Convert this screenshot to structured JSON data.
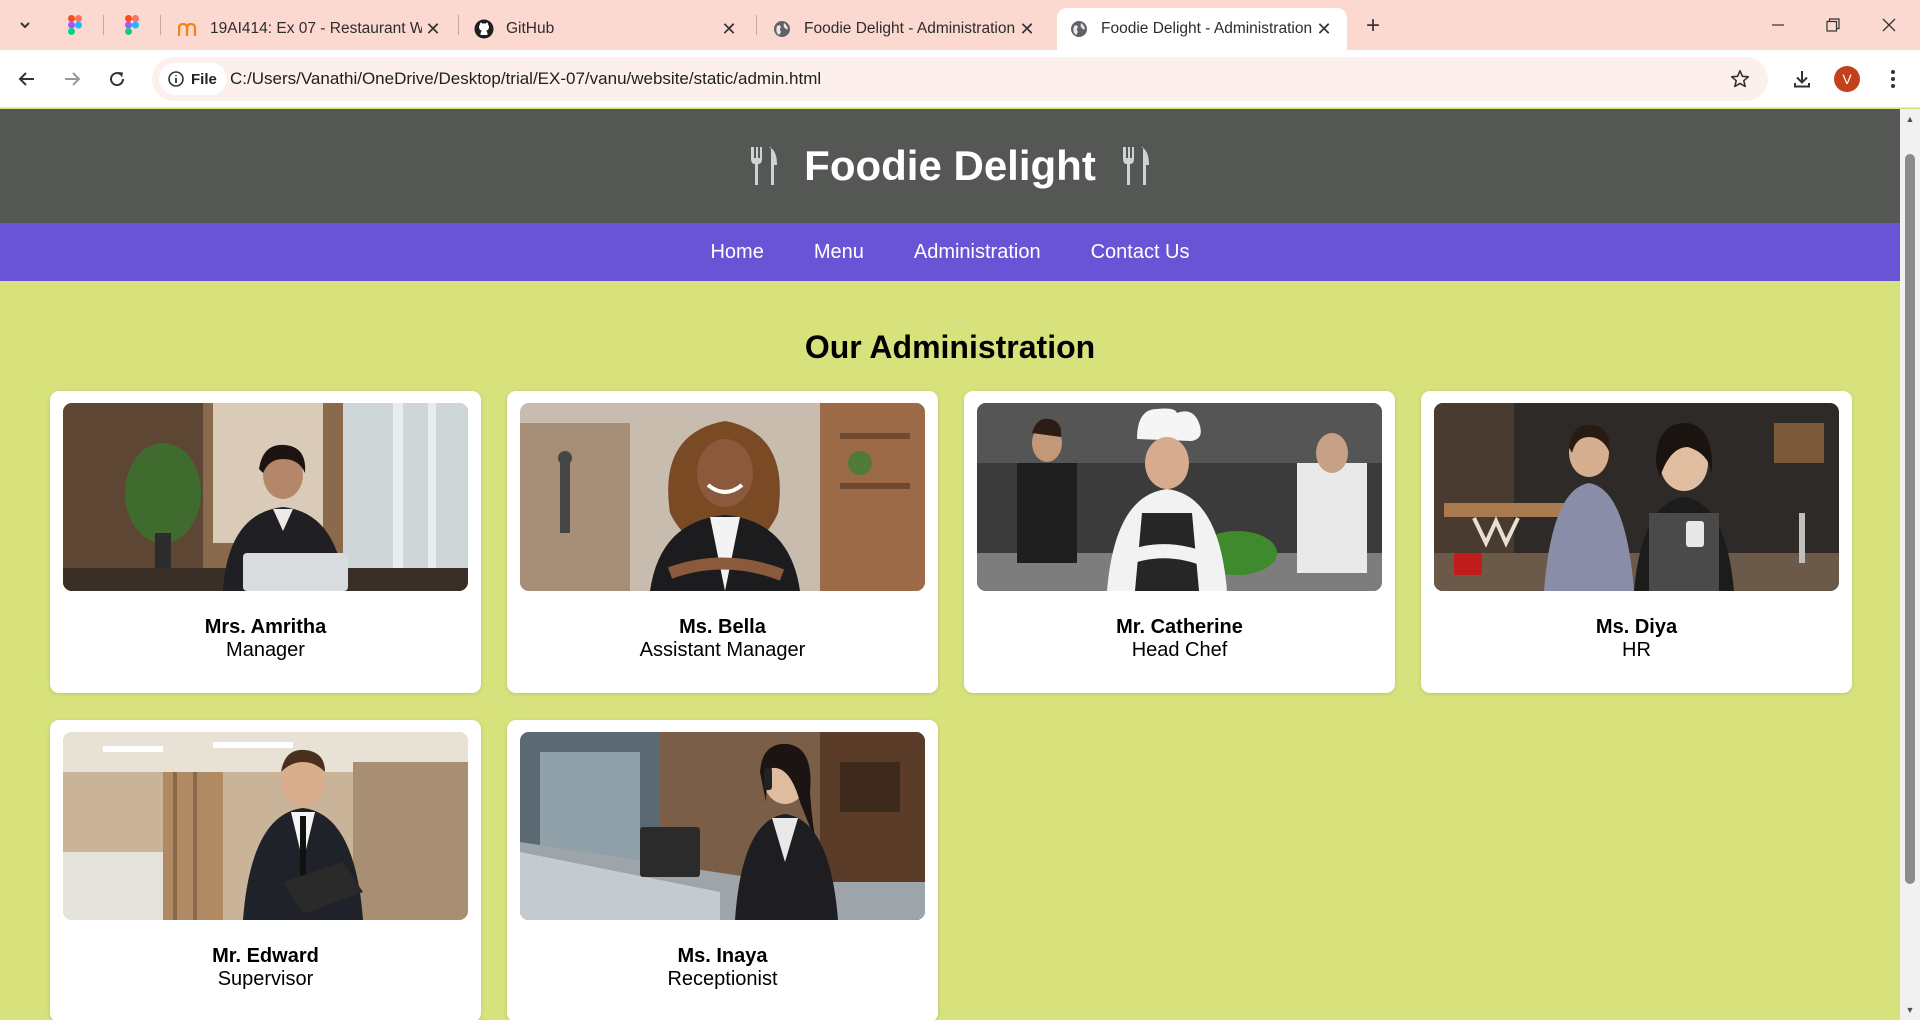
{
  "browser": {
    "tabs": [
      {
        "title": "",
        "icon": "figma-icon",
        "pinned": true
      },
      {
        "title": "",
        "icon": "figma-icon",
        "pinned": true
      },
      {
        "title": "19AI414: Ex 07 - Restaurant We",
        "icon": "moodle-icon"
      },
      {
        "title": "GitHub",
        "icon": "github-icon"
      },
      {
        "title": "Foodie Delight - Administration",
        "icon": "globe-icon"
      },
      {
        "title": "Foodie Delight - Administration",
        "icon": "globe-icon",
        "active": true
      }
    ],
    "file_chip": "File",
    "url": "C:/Users/Vanathi/OneDrive/Desktop/trial/EX-07/vanu/website/static/admin.html",
    "profile_initial": "V",
    "accent": "#fbd8d0"
  },
  "site": {
    "title": "Foodie Delight",
    "header_color": "#555754",
    "nav_color": "#6a54d6",
    "background": "#d7e27c",
    "nav": [
      "Home",
      "Menu",
      "Administration",
      "Contact Us"
    ],
    "section_title": "Our Administration",
    "staff": [
      {
        "name": "Mrs. Amritha",
        "role": "Manager"
      },
      {
        "name": "Ms. Bella",
        "role": "Assistant Manager"
      },
      {
        "name": "Mr. Catherine",
        "role": "Head Chef"
      },
      {
        "name": "Ms. Diya",
        "role": "HR"
      },
      {
        "name": "Mr. Edward",
        "role": "Supervisor"
      },
      {
        "name": "Ms. Inaya",
        "role": "Receptionist"
      }
    ]
  }
}
